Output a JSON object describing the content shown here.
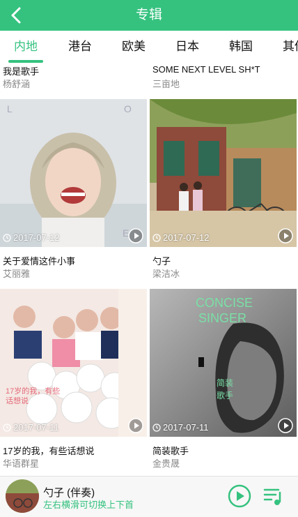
{
  "header": {
    "title": "专辑"
  },
  "tabs": [
    {
      "label": "内地",
      "active": true
    },
    {
      "label": "港台"
    },
    {
      "label": "欧美"
    },
    {
      "label": "日本"
    },
    {
      "label": "韩国"
    },
    {
      "label": "其他"
    }
  ],
  "top_row": [
    {
      "name": "我是歌手",
      "artist": "杨舒涵"
    },
    {
      "name": "SOME NEXT LEVEL SH*T",
      "artist": "三亩地"
    }
  ],
  "albums": [
    {
      "name": "关于爱情这件小事",
      "artist": "艾丽雅",
      "date": "2017-07-12",
      "cover_letters": [
        "L",
        "O",
        "E"
      ]
    },
    {
      "name": "勺子",
      "artist": "梁洁冰",
      "date": "2017-07-12"
    },
    {
      "name": "17岁的我，有些话想说",
      "artist": "华语群星",
      "date": "2017-07-11",
      "cover_text": "17岁的我，有些话想说"
    },
    {
      "name": "简装歌手",
      "artist": "金贵晟",
      "date": "2017-07-11",
      "cover_text_1": "CONCISE",
      "cover_text_2": "SINGER",
      "cover_text_3": "简装",
      "cover_text_4": "歌手"
    }
  ],
  "player": {
    "title": "勺子 (伴奏)",
    "subtitle": "左右横滑可切换上下首"
  },
  "colors": {
    "accent": "#35c27f"
  }
}
